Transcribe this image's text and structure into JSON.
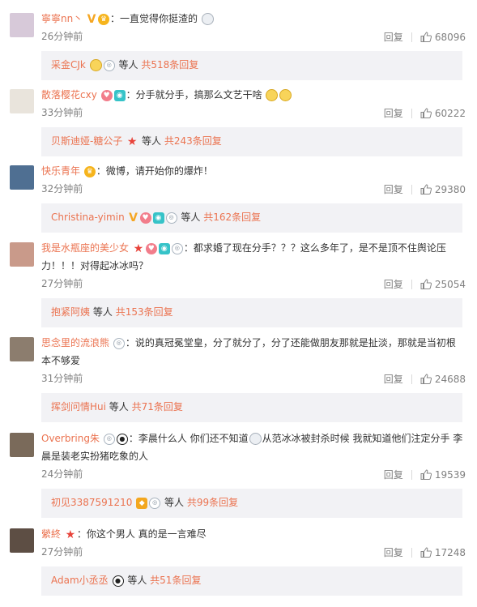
{
  "comments": [
    {
      "user": "寧寧nn丶",
      "text": "：一直觉得你挺渣的",
      "time": "26分钟前",
      "reply_label": "回复",
      "likes": "68096",
      "avatar_color": "#d7c9d9",
      "reply": {
        "users": "采金CJk",
        "suffix": "等人",
        "count": "共518条回复"
      }
    },
    {
      "user": "散落樱花cxy",
      "text": "：分手就分手，搞那么文艺干啥",
      "time": "33分钟前",
      "reply_label": "回复",
      "likes": "60222",
      "avatar_color": "#e9e4dc",
      "reply": {
        "users": "贝斯迪娅-糖公子",
        "suffix": "等人",
        "count": "共243条回复"
      }
    },
    {
      "user": "快乐青年",
      "text": "：微博，请开始你的爆炸！",
      "time": "32分钟前",
      "reply_label": "回复",
      "likes": "29380",
      "avatar_color": "#4f6f92",
      "reply": {
        "users": "Christina-yimin",
        "suffix": "等人",
        "count": "共162条回复"
      }
    },
    {
      "user": "我是水瓶座的美少女",
      "text_line1": "：都求婚了现在分手？？？这么多年了，是不是顶不住舆论压",
      "text_line2": "力！！！对得起冰冰吗？",
      "time": "27分钟前",
      "reply_label": "回复",
      "likes": "25054",
      "avatar_color": "#c99a8a",
      "reply": {
        "users": "抱紧阿姨",
        "suffix": "等人",
        "count": "共153条回复"
      }
    },
    {
      "user": "思念里的流浪熊",
      "text_line1": "：说的真冠冕堂皇，分了就分了，分了还能做朋友那就是扯淡，那就是当初根",
      "text_line2": "本不够爱",
      "time": "31分钟前",
      "reply_label": "回复",
      "likes": "24688",
      "avatar_color": "#8c7d6e",
      "reply": {
        "users": "挥剑问情Hui",
        "suffix": "等人",
        "count": "共71条回复"
      }
    },
    {
      "user": "Overbring朱",
      "text_line1a": "：李晨什么人 你们还不知道",
      "text_line1b": "从范冰冰被封杀时候 我就知道他们注定分手 李",
      "text_line2": "晨是装老实扮猪吃象的人",
      "time": "24分钟前",
      "reply_label": "回复",
      "likes": "19539",
      "avatar_color": "#7a6a5a",
      "reply": {
        "users": "初见3387591210",
        "suffix": "等人",
        "count": "共99条回复"
      }
    },
    {
      "user": "縈終",
      "text": "：你这个男人 真的是一言难尽",
      "time": "27分钟前",
      "reply_label": "回复",
      "likes": "17248",
      "avatar_color": "#5d4e44",
      "reply": {
        "users": "Adam小丞丞",
        "suffix": "等人",
        "count": "共51条回复"
      }
    }
  ],
  "colors": {
    "username": "#eb7350",
    "meta_gray": "#808080",
    "reply_bg": "#f2f2f5"
  }
}
